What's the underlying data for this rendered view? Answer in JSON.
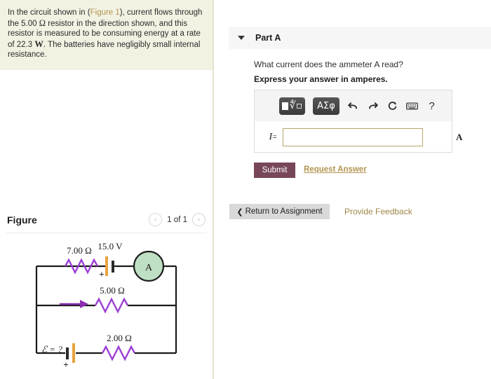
{
  "problem": {
    "line1_a": "In the circuit shown in (",
    "figure_link": "Figure 1",
    "line1_b": "), current flows",
    "line2_a": "through the 5.00 ",
    "ohm": "Ω",
    "line2_b": " resistor in the direction shown,",
    "line3": "and this resistor is measured to be consuming energy",
    "line4_a": "at a rate of 22.3 ",
    "watt": "W",
    "line4_b": ". The batteries have negligibly",
    "line5": "small internal resistance."
  },
  "figure": {
    "title": "Figure",
    "pager_label": "1 of 1",
    "prev_icon": "‹",
    "next_icon": "›",
    "circuit": {
      "r_top_label": "7.00 Ω",
      "battery_top_label": "15.0 V",
      "battery_top_sign": "+",
      "ammeter_label": "A",
      "r_mid_label": "5.00 Ω",
      "emf_label": "ℰ = ?",
      "emf_sign": "+",
      "r_bottom_label": "2.00 Ω"
    },
    "colors": {
      "resistor": "#9b3fd4",
      "arrow": "#8a2fb0",
      "ammeter_fill": "#bfdfc4",
      "battery_plate": "#e8a33d",
      "wire": "#1a1a1a"
    }
  },
  "part_a": {
    "title": "Part A",
    "question": "What current does the ammeter A read?",
    "instruction": "Express your answer in amperes.",
    "answer": {
      "variable": "I",
      "equals": "=",
      "value": "",
      "placeholder": "",
      "unit": "A"
    },
    "toolbar": {
      "template_root": "∜⎕",
      "greek": "ΑΣφ",
      "undo": "⮤",
      "redo": "⮥",
      "reset": "↺",
      "keyboard": "keyboard",
      "help": "?"
    },
    "submit_label": "Submit",
    "request_answer_label": "Request Answer"
  },
  "footer": {
    "return_chevron": "❮",
    "return_label": "Return to Assignment",
    "feedback_label": "Provide Feedback"
  },
  "colors": {
    "submit_bg": "#77465a",
    "link_gold": "#b39552",
    "feedback_gold": "#9c8647",
    "problem_bg": "#f2f2e3",
    "input_border": "#b5a66b"
  }
}
